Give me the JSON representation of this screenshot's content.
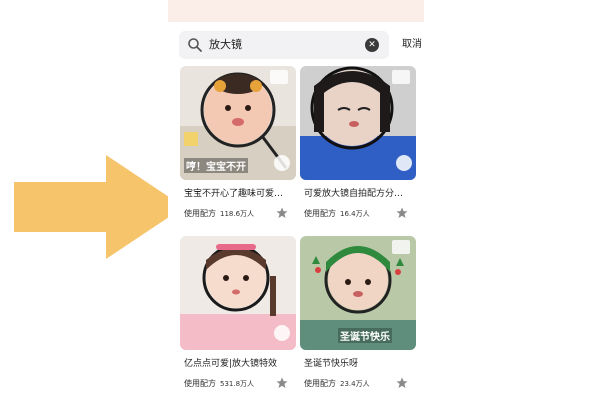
{
  "search": {
    "query": "放大镜",
    "cancel_label": "取消",
    "clear_icon": "clear-icon",
    "search_icon": "search-icon"
  },
  "results": [
    {
      "title": "宝宝不开心了趣味可爱…",
      "use_label": "使用配方",
      "use_count": "118.6万人",
      "overlay_text": "哼！宝宝不开",
      "accent": "#f4c542"
    },
    {
      "title": "可爱放大镜自拍配方分…",
      "use_label": "使用配方",
      "use_count": "16.4万人",
      "overlay_text": "",
      "accent": "#3a6fd8"
    },
    {
      "title": "亿点点可爱|放大镜特效",
      "use_label": "使用配方",
      "use_count": "531.8万人",
      "overlay_text": "",
      "accent": "#f3a9b8"
    },
    {
      "title": "圣诞节快乐呀",
      "use_label": "使用配方",
      "use_count": "23.4万人",
      "overlay_text": "圣诞节快乐",
      "accent": "#2f8a3e"
    }
  ],
  "colors": {
    "arrow": "#f6c46b",
    "search_bg": "#f2f2f4",
    "top_strip": "#fbeee9"
  }
}
